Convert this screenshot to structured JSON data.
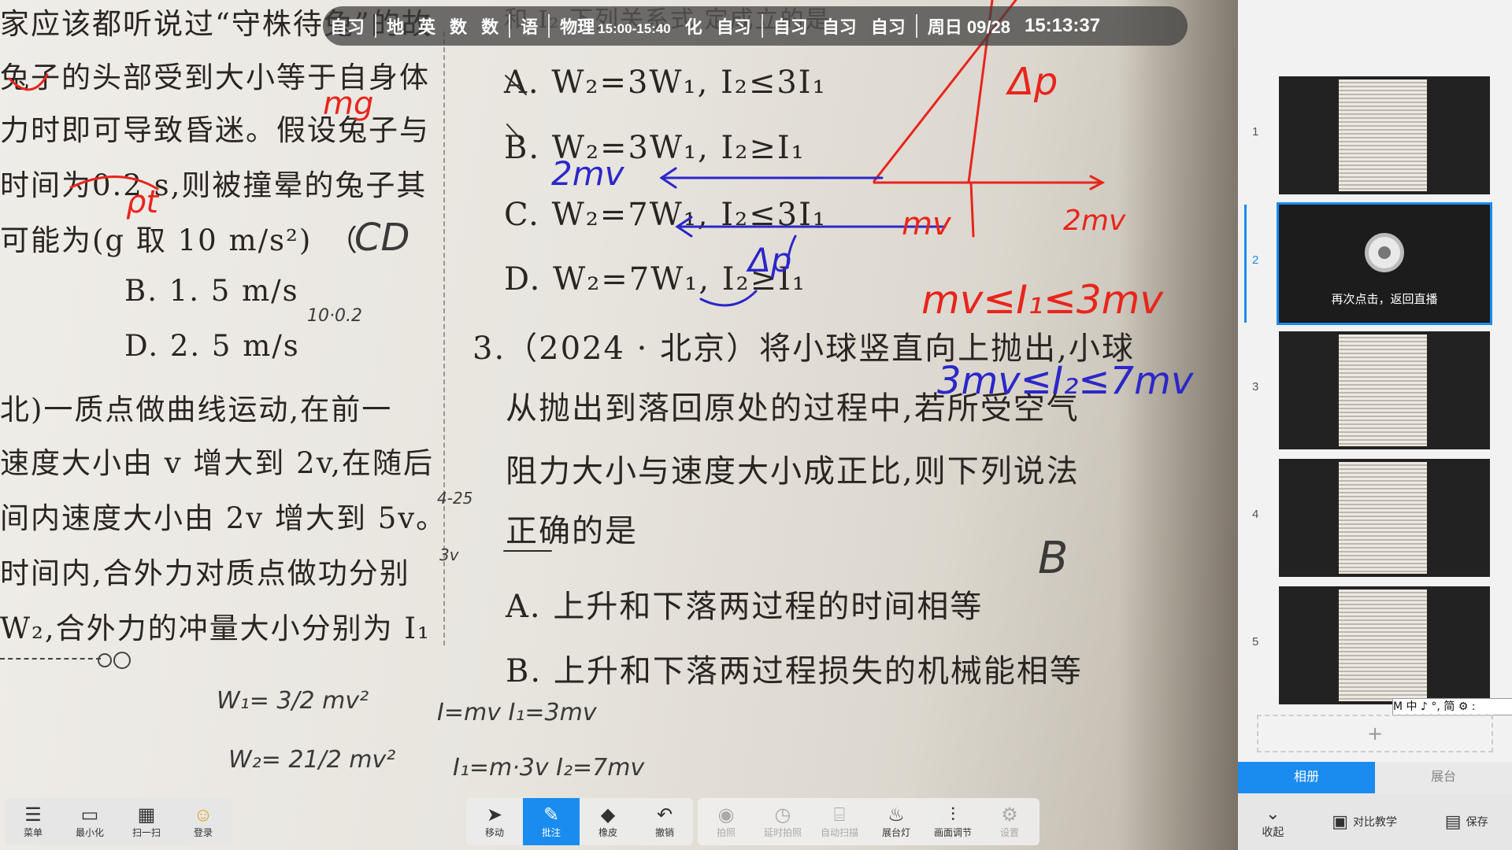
{
  "status_bar": {
    "items": [
      "自习",
      "地",
      "英",
      "数",
      "数",
      "语"
    ],
    "current_subject": "物理",
    "current_time_range": "15:00-15:40",
    "items_after": [
      "化",
      "自习",
      "自习",
      "自习",
      "自习"
    ],
    "date": "周日 09/28",
    "clock": "15:13:37"
  },
  "book": {
    "left_lines": [
      "家应该都听说过“守株待兔”的故",
      "兔子的头部受到大小等于自身体",
      "力时即可导致昏迷。假设兔子与",
      "时间为0.2 s,则被撞晕的兔子其",
      "可能为(g 取 10 m/s²)　（",
      "B. 1. 5 m/s",
      "D. 2. 5 m/s",
      "北)一质点做曲线运动,在前一",
      "速度大小由 v 增大到 2v,在随后",
      "间内速度大小由 2v 增大到 5v。",
      "时间内,合外力对质点做功分别",
      "W₂,合外力的冲量大小分别为 I₁"
    ],
    "right_top": "和 I₂  下列关系式    定成立的是",
    "options_q2": [
      "A. W₂=3W₁, I₂≤3I₁",
      "B. W₂=3W₁, I₂≥I₁",
      "C. W₂=7W₁, I₂≤3I₁",
      "D. W₂=7W₁, I₂≥I₁"
    ],
    "q3_lines": [
      "3.（2024 · 北京）将小球竖直向上抛出,小球",
      "从抛出到落回原处的过程中,若所受空气",
      "阻力大小与速度大小成正比,则下列说法",
      "正确的是",
      "A. 上升和下落两过程的时间相等",
      "B. 上升和下落两过程损失的机械能相等"
    ]
  },
  "annotations": {
    "answer_q1": "CD",
    "answer_q3": "B",
    "ink_red": [
      "mg",
      "ρt",
      "mv",
      "2mv",
      "mv≤I₁≤3mv",
      "Δp"
    ],
    "ink_blue": [
      "2mv",
      "Δp",
      "3mv≤I₂≤7mv"
    ],
    "ink_dark": [
      "W₁= 3/2 mv²",
      "W₂= 21/2 mv²",
      "I=mv  I₁=3mv",
      "I₁=m·3v  I₂=7mv",
      "4-25",
      "3v",
      "10·0.2"
    ],
    "colors": {
      "red": "#e8251c",
      "blue": "#2b27c9",
      "dark": "#3a3a3a"
    }
  },
  "toolbar_left": [
    {
      "icon": "menu-icon",
      "label": "菜单"
    },
    {
      "icon": "minimize-icon",
      "label": "最小化"
    },
    {
      "icon": "qr-icon",
      "label": "扫一扫"
    },
    {
      "icon": "user-icon",
      "label": "登录"
    }
  ],
  "toolbar_center": [
    {
      "icon": "cursor-icon",
      "label": "移动"
    },
    {
      "icon": "pen-icon",
      "label": "批注"
    },
    {
      "icon": "eraser-icon",
      "label": "橡皮"
    },
    {
      "icon": "undo-icon",
      "label": "撤销"
    }
  ],
  "toolbar_right": [
    {
      "icon": "camera-icon",
      "label": "拍照"
    },
    {
      "icon": "timer-icon",
      "label": "延时拍照"
    },
    {
      "icon": "scan-icon",
      "label": "自动扫描"
    },
    {
      "icon": "lamp-icon",
      "label": "展台灯"
    },
    {
      "icon": "sliders-icon",
      "label": "画面调节"
    },
    {
      "icon": "gear-icon",
      "label": "设置"
    }
  ],
  "panel": {
    "thumbnails": [
      "1",
      "2",
      "3",
      "4",
      "5"
    ],
    "return_live": "再次点击，返回直播",
    "add_page": "+",
    "ime": "M 中 ♪ °, 简 ⚙ :",
    "tabs": [
      "相册",
      "展台"
    ],
    "bottom": [
      {
        "icon": "chevron-down-icon",
        "label": "收起"
      },
      {
        "icon": "compare-icon",
        "label": "对比教学"
      },
      {
        "icon": "save-icon",
        "label": "保存"
      }
    ]
  }
}
